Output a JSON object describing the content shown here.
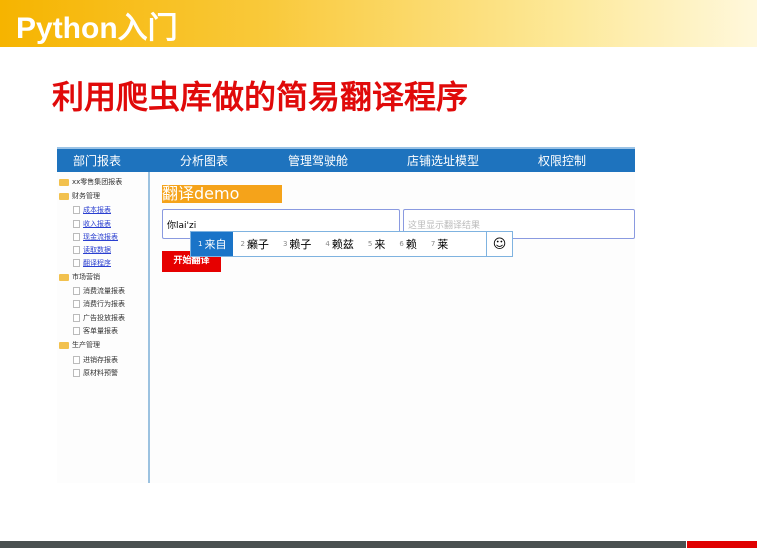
{
  "slide": {
    "header": "Python入门",
    "title": "利用爬虫库做的简易翻译程序"
  },
  "nav": [
    "部门报表",
    "分析图表",
    "管理驾驶舱",
    "店铺选址模型",
    "权限控制"
  ],
  "sidebar": {
    "root": "xx零售集团报表",
    "groups": [
      {
        "label": "财务管理",
        "items": [
          "成本报表",
          "收入报表",
          "现金流报表",
          "读取数据",
          "翻译程序"
        ]
      },
      {
        "label": "市场营销",
        "items": [
          "消费流量报表",
          "消费行为报表",
          "广告投放报表",
          "客单量报表"
        ]
      },
      {
        "label": "生产管理",
        "items": [
          "进销存报表",
          "原材料预警"
        ]
      }
    ]
  },
  "main": {
    "heading": "翻译demo",
    "input_value": "你lai'zi",
    "output_placeholder": "这里显示翻译结果",
    "button": "开始翻译"
  },
  "ime": {
    "candidates": [
      {
        "n": "1",
        "t": "来自"
      },
      {
        "n": "2",
        "t": "癞子"
      },
      {
        "n": "3",
        "t": "赖子"
      },
      {
        "n": "4",
        "t": "赖兹"
      },
      {
        "n": "5",
        "t": "来"
      },
      {
        "n": "6",
        "t": "赖"
      },
      {
        "n": "7",
        "t": "莱"
      }
    ],
    "emoji": "☺"
  }
}
